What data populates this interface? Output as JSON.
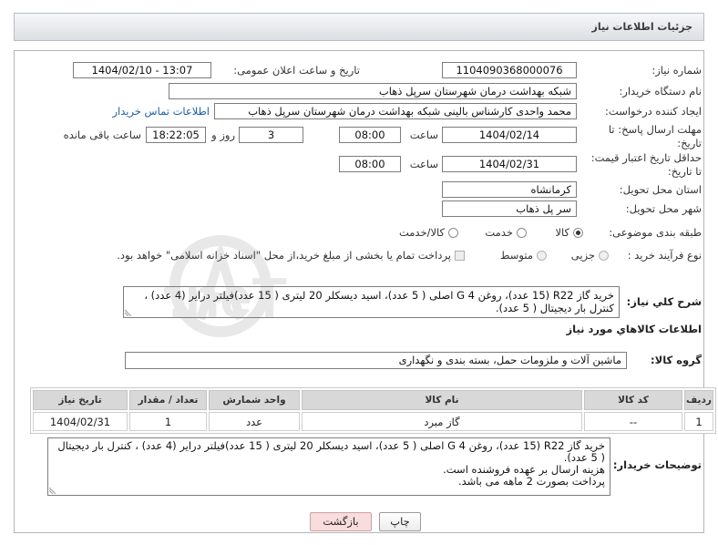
{
  "header": {
    "title": "جزئیات اطلاعات نیاز"
  },
  "need_number": {
    "label": "شماره نیاز:",
    "value": "1104090368000076"
  },
  "announce": {
    "label": "تاریخ و ساعت اعلان عمومی:",
    "value": "1404/02/10 - 13:07"
  },
  "buyer_org": {
    "label": "نام دستگاه خریدار:",
    "value": "شبکه بهداشت درمان شهرستان سرپل ذهاب"
  },
  "requester": {
    "label": "ایجاد کننده درخواست:",
    "value": "محمد واحدی کارشناس بالینی شبکه بهداشت درمان شهرستان سرپل ذهاب",
    "contact_link": "اطلاعات تماس خریدار"
  },
  "reply_deadline": {
    "label_line1": "مهلت ارسال پاسخ: تا",
    "label_line2": "تاریخ:",
    "date": "1404/02/14",
    "time_label": "ساعت",
    "time": "08:00",
    "days": "3",
    "days_label": "روز و",
    "remaining_time": "18:22:05",
    "remaining_label": "ساعت باقی مانده"
  },
  "price_validity": {
    "label_line1": "حداقل تاریخ اعتبار قیمت:",
    "label_line2": "تا تاریخ:",
    "date": "1404/02/31",
    "time_label": "ساعت",
    "time": "08:00"
  },
  "delivery_province": {
    "label": "استان محل تحویل:",
    "value": "کرمانشاه"
  },
  "delivery_city": {
    "label": "شهر محل تحویل:",
    "value": "سر پل ذهاب"
  },
  "category": {
    "label": "طبقه بندی موضوعی:",
    "options": [
      {
        "label": "کالا",
        "checked": true
      },
      {
        "label": "خدمت",
        "checked": false
      },
      {
        "label": "کالا/خدمت",
        "checked": false
      }
    ]
  },
  "process_type": {
    "label": "نوع فرآیند خرید :",
    "options": [
      {
        "label": "جزیی",
        "checked": false
      },
      {
        "label": "متوسط",
        "checked": false
      }
    ],
    "treasury": {
      "label": "پرداخت تمام یا بخشی از مبلغ خرید،از محل \"اسناد خزانه اسلامی\" خواهد بود.",
      "checked": false
    }
  },
  "description": {
    "label": "شرح کلي نياز:",
    "text": "خرید گاز R22 (15 عدد)، روغن G 4 اصلی ( 5 عدد)، اسید دیسکلر 20 لیتری ( 15 عدد)فیلتر درایر (4 عدد) ، کنترل بار دیجیتال ( 5 عدد)."
  },
  "items_section": {
    "title": "اطلاعات كالاهاي مورد نياز"
  },
  "goods_group": {
    "label": "گروه کالا:",
    "value": "ماشین آلات و ملزومات حمل، بسته بندی و نگهداری"
  },
  "table": {
    "columns": [
      "ردیف",
      "کد کالا",
      "نام کالا",
      "واحد شمارش",
      "تعداد / مقدار",
      "تاریخ نیاز"
    ],
    "rows": [
      [
        "1",
        "--",
        "گاز مبرد",
        "عدد",
        "1",
        "1404/02/31"
      ]
    ]
  },
  "buyer_notes": {
    "label": "توضیحات خریدار:",
    "lines": [
      "خرید گاز R22 (15 عدد)، روغن G 4 اصلی ( 5 عدد)، اسید دیسکلر 20 لیتری ( 15 عدد)فیلتر درایر (4 عدد) ، کنترل بار دیجیتال ( 5 عدد).",
      "هزینه ارسال بر عهده فروشنده است.",
      "پرداخت بصورت 2 ماهه می باشد."
    ]
  },
  "buttons": {
    "print": "چاپ",
    "back": "بازگشت"
  },
  "colors": {
    "link": "#1a5ea8",
    "back_button": "#f9dcdc",
    "table_header": "#d8d8d8"
  },
  "watermark": {
    "text": "AriaTender.neT"
  }
}
